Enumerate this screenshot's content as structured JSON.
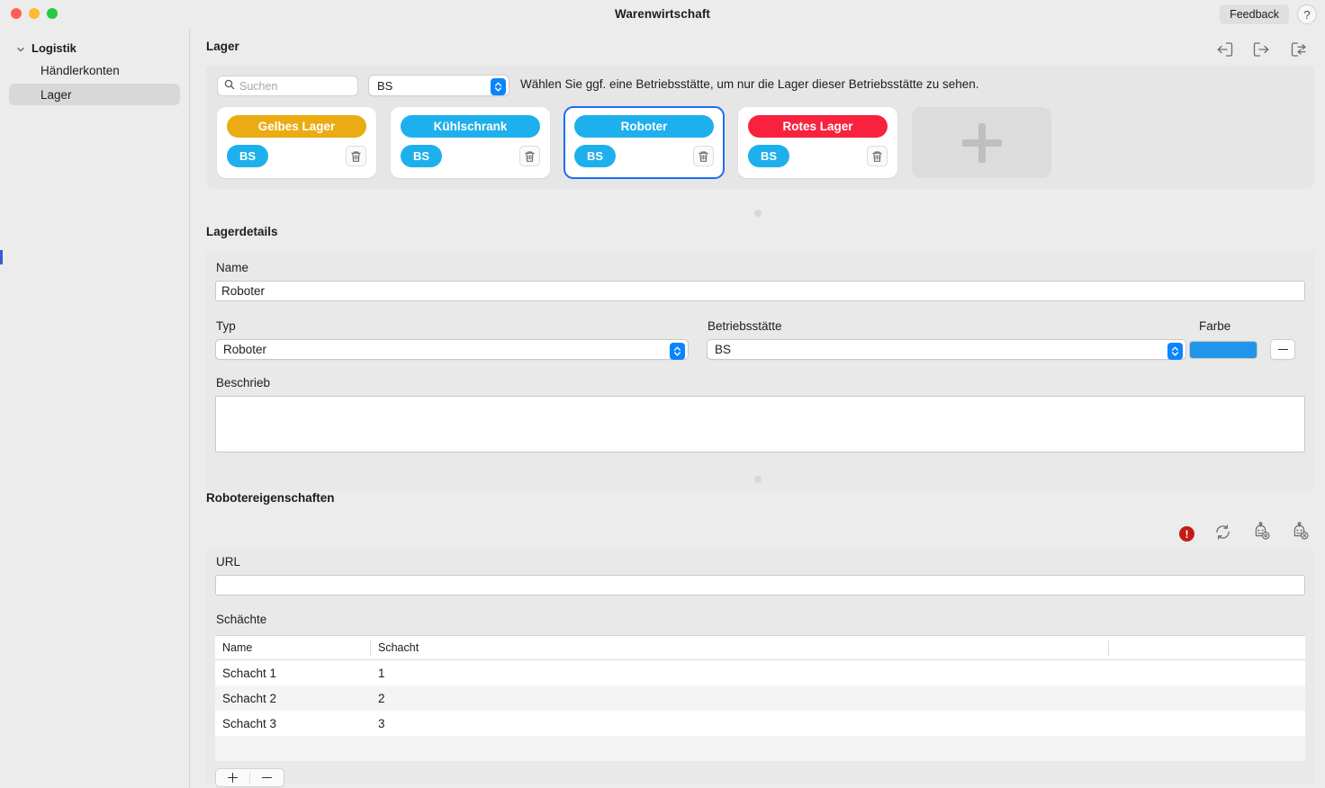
{
  "window": {
    "title": "Warenwirtschaft",
    "feedback_label": "Feedback",
    "help_label": "?"
  },
  "sidebar": {
    "group_label": "Logistik",
    "items": [
      {
        "label": "Händlerkonten",
        "selected": false
      },
      {
        "label": "Lager",
        "selected": true
      }
    ]
  },
  "toolbar": {
    "icons": [
      "import-icon",
      "export-icon",
      "sync-icon"
    ]
  },
  "lager_section": {
    "title": "Lager",
    "search": {
      "placeholder": "Suchen",
      "value": ""
    },
    "betriebsstaette_filter": {
      "value": "BS"
    },
    "hint": "Wählen Sie ggf. eine Betriebsstätte, um nur die Lager dieser Betriebsstätte zu sehen.",
    "cards": [
      {
        "name": "Gelbes Lager",
        "color": "#eaac12",
        "bs": "BS",
        "selected": false
      },
      {
        "name": "Kühlschrank",
        "color": "#1eb0ec",
        "bs": "BS",
        "selected": false
      },
      {
        "name": "Roboter",
        "color": "#1eb0ec",
        "bs": "BS",
        "selected": true
      },
      {
        "name": "Rotes Lager",
        "color": "#f8223f",
        "bs": "BS",
        "selected": false
      }
    ],
    "add_card_label": "+"
  },
  "details_section": {
    "title": "Lagerdetails",
    "name_label": "Name",
    "name_value": "Roboter",
    "typ_label": "Typ",
    "typ_value": "Roboter",
    "betriebsstaette_label": "Betriebsstätte",
    "betriebsstaette_value": "BS",
    "farbe_label": "Farbe",
    "farbe_value": "#2196e8",
    "beschrieb_label": "Beschrieb",
    "beschrieb_value": ""
  },
  "robot_section": {
    "title": "Robotereigenschaften",
    "icons": [
      "error-icon",
      "refresh-icon",
      "robot-settings-icon",
      "robot-remove-icon"
    ],
    "error_glyph": "!",
    "url_label": "URL",
    "url_value": "",
    "schaechte_label": "Schächte",
    "table": {
      "columns": [
        "Name",
        "Schacht",
        ""
      ],
      "rows": [
        {
          "name": "Schacht 1",
          "schacht": "1"
        },
        {
          "name": "Schacht 2",
          "schacht": "2"
        },
        {
          "name": "Schacht 3",
          "schacht": "3"
        }
      ]
    },
    "add_label": "+",
    "remove_label": "−"
  }
}
